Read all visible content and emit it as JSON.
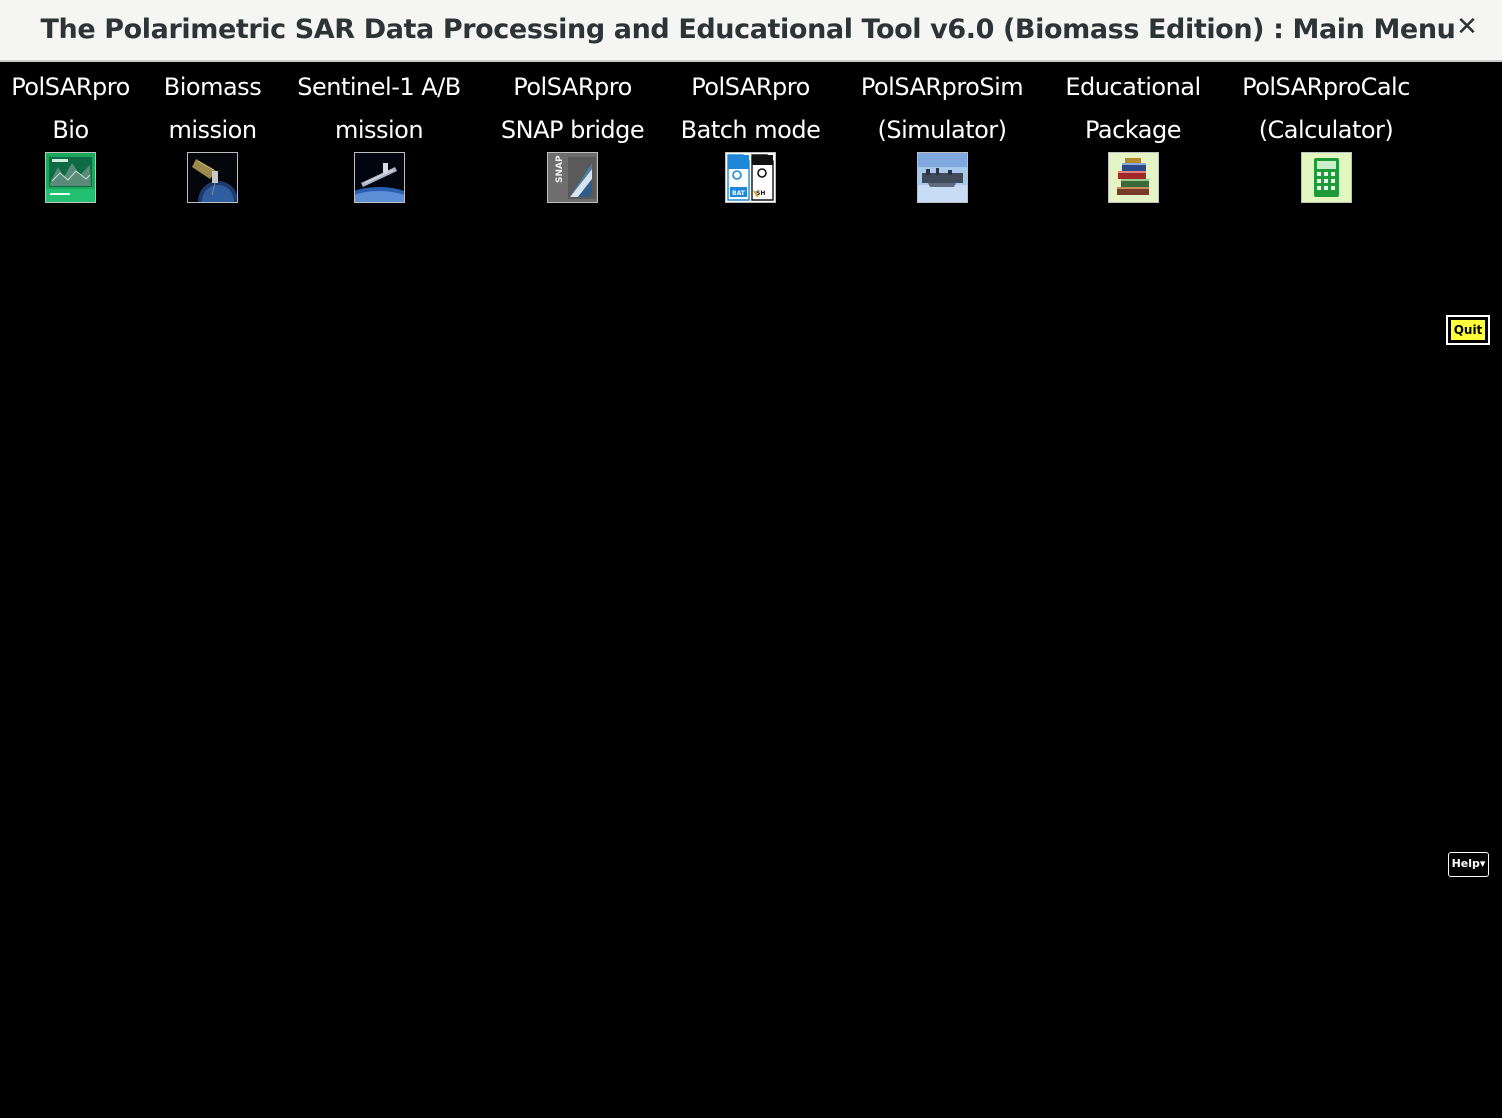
{
  "window": {
    "title": "The Polarimetric SAR Data Processing and Educational Tool v6.0 (Biomass Edition) : Main Menu",
    "close_glyph": "✕"
  },
  "menu": [
    {
      "line1": "PolSARpro",
      "line2": "Bio",
      "icon": "polsarpro-bio-icon"
    },
    {
      "line1": "Biomass",
      "line2": "mission",
      "icon": "biomass-satellite-icon"
    },
    {
      "line1": "Sentinel-1 A/B",
      "line2": "mission",
      "icon": "sentinel-satellite-icon"
    },
    {
      "line1": "PolSARpro",
      "line2": "SNAP bridge",
      "icon": "snap-logo-icon"
    },
    {
      "line1": "PolSARpro",
      "line2": "Batch mode",
      "icon": "batch-files-icon"
    },
    {
      "line1": "PolSARproSim",
      "line2": "(Simulator)",
      "icon": "simulator-icon"
    },
    {
      "line1": "Educational",
      "line2": "Package",
      "icon": "books-icon"
    },
    {
      "line1": "PolSARproCalc",
      "line2": "(Calculator)",
      "icon": "calculator-icon"
    }
  ],
  "buttons": {
    "quit": "Quit",
    "help": "Help▾"
  },
  "colors": {
    "background": "#000000",
    "titlebar": "#f5f5f4",
    "quit": "#ffff3c"
  }
}
